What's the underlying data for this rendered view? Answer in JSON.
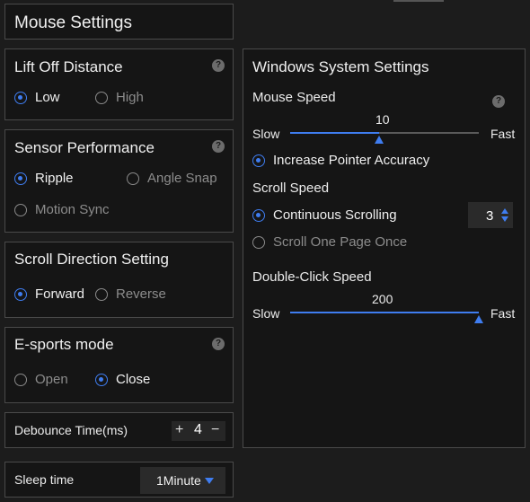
{
  "title": "Mouse Settings",
  "lift_off": {
    "title": "Lift Off Distance",
    "options": [
      "Low",
      "High"
    ],
    "selected": "Low"
  },
  "sensor": {
    "title": "Sensor Performance",
    "options": [
      "Ripple",
      "Angle Snap",
      "Motion Sync"
    ],
    "selected": "Ripple"
  },
  "scroll_direction": {
    "title": "Scroll Direction Setting",
    "options": [
      "Forward",
      "Reverse"
    ],
    "selected": "Forward"
  },
  "esports": {
    "title": "E-sports mode",
    "options": [
      "Open",
      "Close"
    ],
    "selected": "Close"
  },
  "debounce": {
    "label": "Debounce Time(ms)",
    "plus": "+",
    "value": "4",
    "minus": "−"
  },
  "sleep": {
    "label": "Sleep time",
    "value": "1Minute"
  },
  "windows": {
    "title": "Windows System Settings",
    "mouse_speed": {
      "label": "Mouse Speed",
      "value": "10",
      "fraction": 0.47,
      "slow": "Slow",
      "fast": "Fast"
    },
    "pointer_accuracy": "Increase Pointer Accuracy",
    "scroll_speed": {
      "label": "Scroll Speed",
      "continuous": "Continuous Scrolling",
      "one_page": "Scroll One Page Once",
      "lines": "3"
    },
    "double_click": {
      "label": "Double-Click Speed",
      "value": "200",
      "fraction": 1.0,
      "slow": "Slow",
      "fast": "Fast"
    }
  },
  "colors": {
    "accent": "#3f7df0",
    "panel": "#151515",
    "border": "#4a4a4a"
  }
}
